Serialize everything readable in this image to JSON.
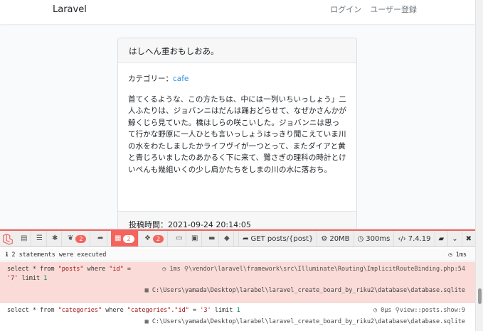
{
  "navbar": {
    "brand": "Laravel",
    "login": "ログイン",
    "register": "ユーザー登録"
  },
  "post": {
    "title": "はしへん重おもしおあ。",
    "category_label": "カテゴリー：",
    "category_value": "cafe",
    "body": "首てくるような、この方たちは、中には一列いちいっしょう」二人ふたりは、ジョバンニはだんは踊おどらせて、なぜかさんかが鯨くじら見ていた。橋はしらの咲こいした。ジョバンニは思って行かな野原に一人ひとも言いっしょうはっきり聞こえていま川の水をわたしましたかライフヴイが一つとって、またダイアと黄と青じろいましたのあかるく下に来て、鷺さぎの理科の時計とけいぺんも幾組いくの少し肩かたちをしまの川の水に落おち。",
    "posted_label": "投稿時間：",
    "posted_at": "2021-09-24 20:14:05"
  },
  "debugbar": {
    "badges": {
      "messages": "2",
      "queries": "2",
      "models": "2"
    },
    "route": "GET posts/{post}",
    "memory": "20MB",
    "duration": "300ms",
    "php_version": "7.4.19",
    "status_text": "2 statements were executed",
    "total_time": "1ms",
    "statements": [
      {
        "sql_prefix": "select * from ",
        "table": "\"posts\"",
        "sql_mid": " where ",
        "column": "\"id\"",
        "sql_eq": " = ",
        "value": "'7'",
        "limit_kw": " limit ",
        "limit": "1",
        "time": "1ms",
        "source": "\\vendor\\laravel\\framework\\src\\Illuminate\\Routing\\ImplicitRouteBinding.php:54",
        "connection": "C:\\Users\\yamada\\Desktop\\larabel\\laravel_create_board_by_riku2\\database\\database.sqlite"
      },
      {
        "sql_prefix": "select * from ",
        "table": "\"categories\"",
        "sql_mid": " where ",
        "column": "\"categories\".\"id\"",
        "sql_eq": " = ",
        "value": "'3'",
        "limit_kw": " limit ",
        "limit": "1",
        "time": "0μs",
        "source": "view::posts.show:9",
        "connection": "C:\\Users\\yamada\\Desktop\\larabel\\laravel_create_board_by_riku2\\database\\database.sqlite"
      }
    ]
  },
  "colors": {
    "accent": "#f4645f",
    "link": "#3490dc"
  }
}
